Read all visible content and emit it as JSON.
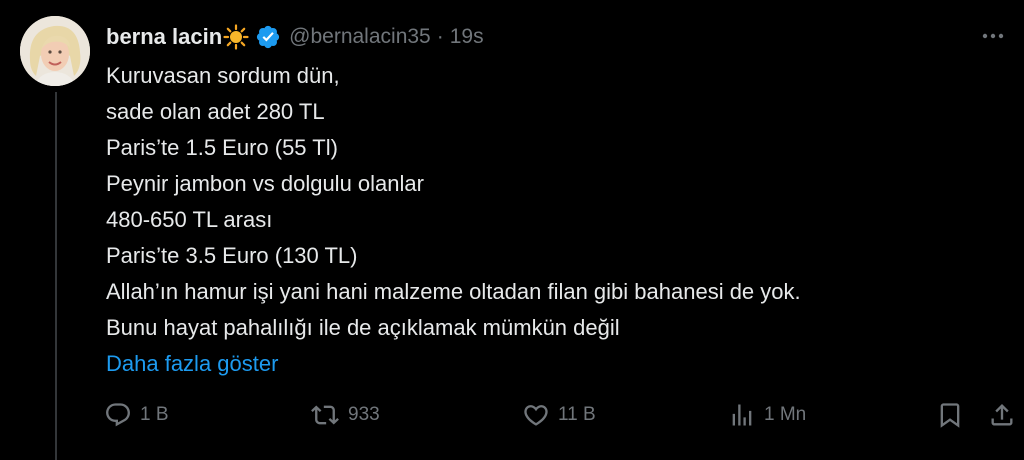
{
  "tweet": {
    "author": {
      "display_name": "berna lacin",
      "emoji": "sun-icon",
      "handle": "@bernalacin35",
      "separator": "·",
      "time": "19s",
      "verified": true
    },
    "lines": [
      "Kuruvasan sordum dün,",
      "sade olan  adet 280 TL",
      "Paris’te 1.5 Euro (55 Tl)",
      "Peynir jambon vs dolgulu olanlar",
      "480-650 TL arası",
      "Paris’te 3.5 Euro (130 TL)",
      "Allah’ın hamur işi yani hani malzeme oltadan filan gibi bahanesi de yok.",
      "Bunu hayat pahalılığı ile de açıklamak mümkün değil"
    ],
    "show_more": "Daha fazla göster",
    "actions": {
      "replies": "1 B",
      "retweets": "933",
      "likes": "11 B",
      "views": "1 Mn"
    }
  },
  "colors": {
    "background": "#000000",
    "text": "#e7e9ea",
    "secondary": "#71767b",
    "link": "#1d9bf0",
    "verified": "#1d9bf0",
    "sun": "#f5a623"
  },
  "icons": {
    "menu": "more-icon",
    "reply": "reply-icon",
    "retweet": "retweet-icon",
    "like": "like-icon",
    "views": "views-icon",
    "bookmark": "bookmark-icon",
    "share": "share-icon"
  }
}
